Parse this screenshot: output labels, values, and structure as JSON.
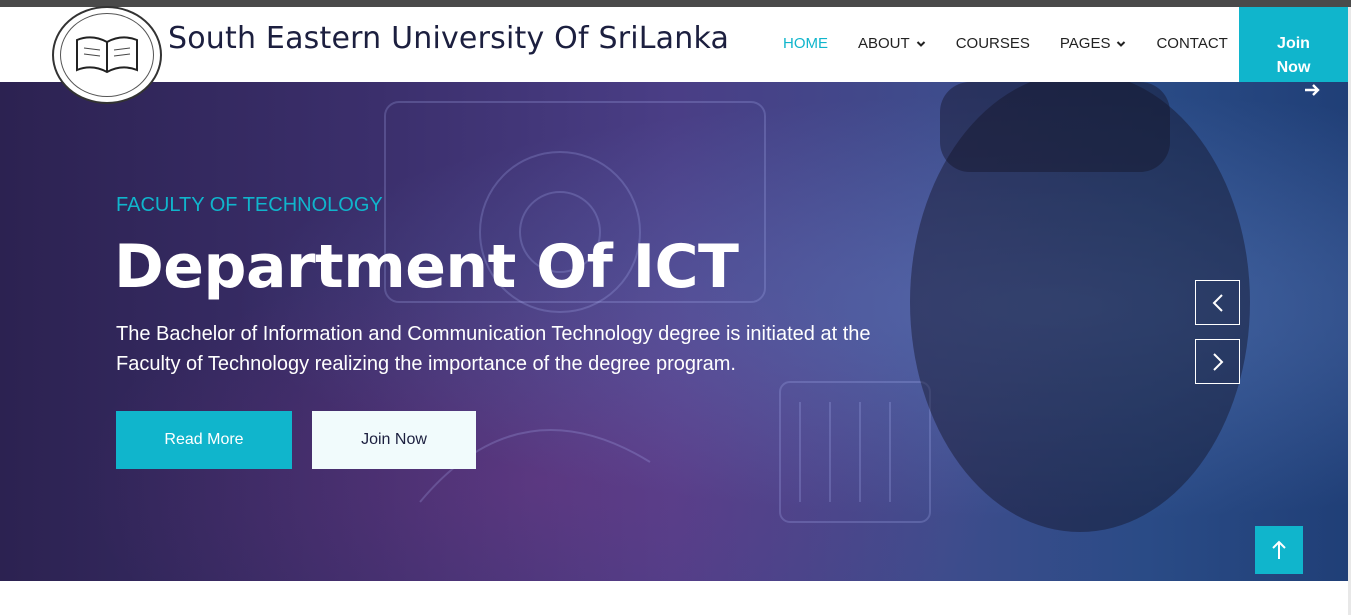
{
  "brand": {
    "name": "South Eastern University Of SriLanka",
    "logo_icon": "university-seal-icon"
  },
  "nav": {
    "items": [
      {
        "label": "HOME",
        "active": true
      },
      {
        "label": "ABOUT",
        "dropdown": true
      },
      {
        "label": "COURSES"
      },
      {
        "label": "PAGES",
        "dropdown": true
      },
      {
        "label": "CONTACT"
      }
    ],
    "join_label_line1": "Join",
    "join_label_line2": "Now"
  },
  "hero": {
    "kicker": "FACULTY OF TECHNOLOGY",
    "title": "Department Of ICT",
    "description": "The Bachelor of Information and Communication Technology degree is initiated at the Faculty of Technology realizing the importance of the degree program.",
    "read_more": "Read More",
    "join_now": "Join Now"
  },
  "colors": {
    "accent": "#10b5cc",
    "brand_text": "#1c1f3f"
  }
}
